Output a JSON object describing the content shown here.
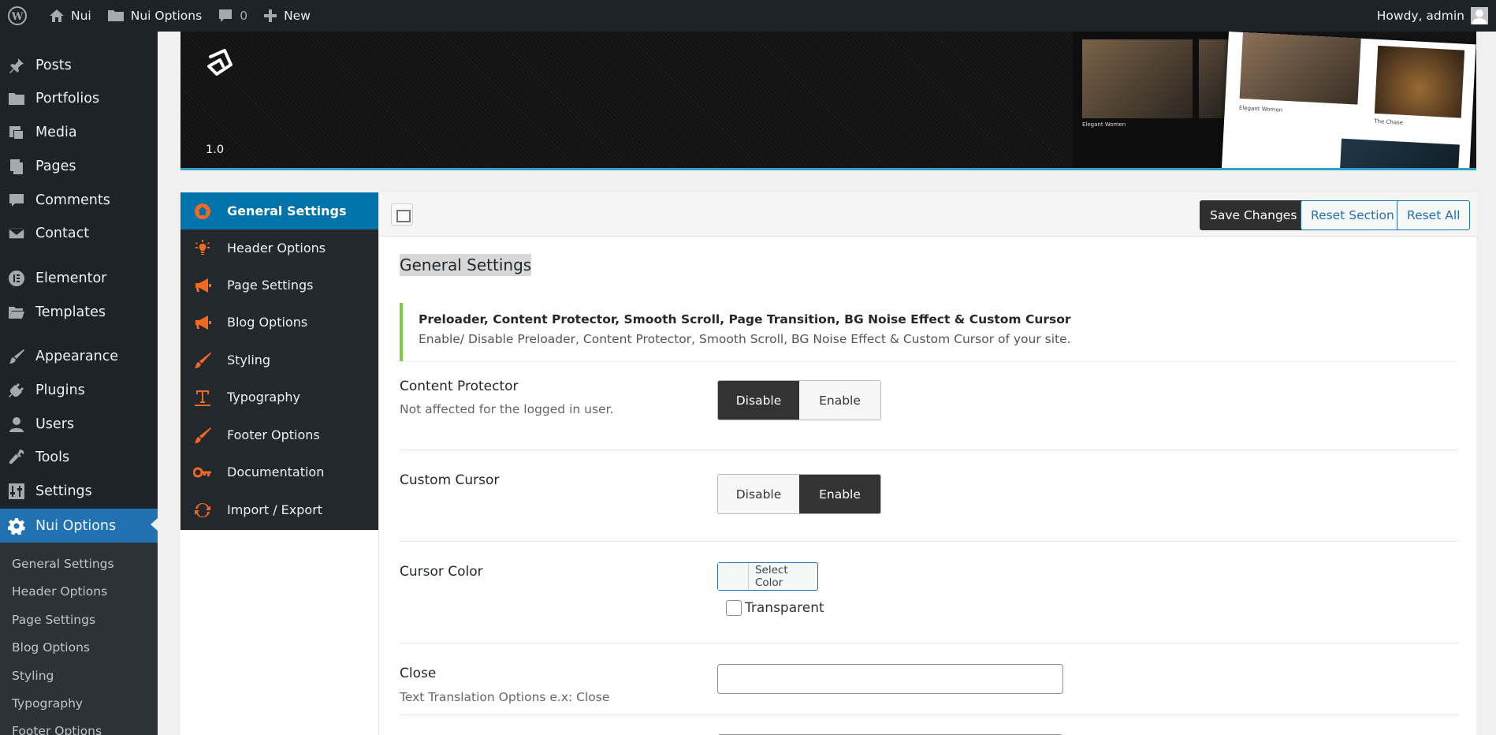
{
  "adminbar": {
    "site_name": "Nui",
    "options_label": "Nui Options",
    "comments_count": "0",
    "new_label": "New",
    "howdy": "Howdy, admin"
  },
  "adminmenu": {
    "items": [
      {
        "label": "Posts",
        "icon": "pushpin-icon"
      },
      {
        "label": "Portfolios",
        "icon": "folder-icon"
      },
      {
        "label": "Media",
        "icon": "media-icon"
      },
      {
        "label": "Pages",
        "icon": "pages-icon"
      },
      {
        "label": "Comments",
        "icon": "comment-icon"
      },
      {
        "label": "Contact",
        "icon": "envelope-icon"
      },
      {
        "label": "Elementor",
        "icon": "elementor-icon"
      },
      {
        "label": "Templates",
        "icon": "folder-open-icon"
      },
      {
        "label": "Appearance",
        "icon": "brush-icon"
      },
      {
        "label": "Plugins",
        "icon": "plug-icon"
      },
      {
        "label": "Users",
        "icon": "user-icon"
      },
      {
        "label": "Tools",
        "icon": "wrench-icon"
      },
      {
        "label": "Settings",
        "icon": "sliders-icon"
      },
      {
        "label": "Nui Options",
        "icon": "gear-icon"
      }
    ],
    "submenu": [
      "General Settings",
      "Header Options",
      "Page Settings",
      "Blog Options",
      "Styling",
      "Typography",
      "Footer Options"
    ]
  },
  "banner": {
    "version": "1.0",
    "caption_1": "Elegant Women",
    "caption_2": "Elegant Women",
    "caption_3": "The Chase"
  },
  "options_nav": {
    "items": [
      {
        "label": "General Settings",
        "icon": "home-icon"
      },
      {
        "label": "Header Options",
        "icon": "lightbulb-icon"
      },
      {
        "label": "Page Settings",
        "icon": "megaphone-icon"
      },
      {
        "label": "Blog Options",
        "icon": "megaphone-icon"
      },
      {
        "label": "Styling",
        "icon": "brush-icon"
      },
      {
        "label": "Typography",
        "icon": "text-icon"
      },
      {
        "label": "Footer Options",
        "icon": "brush-icon"
      },
      {
        "label": "Documentation",
        "icon": "key-icon"
      },
      {
        "label": "Import / Export",
        "icon": "refresh-icon"
      }
    ]
  },
  "toolbar": {
    "save_label": "Save Changes",
    "reset_section_label": "Reset Section",
    "reset_all_label": "Reset All"
  },
  "section": {
    "title": "General Settings",
    "notice_title": "Preloader, Content Protector, Smooth Scroll, Page Transition, BG Noise Effect & Custom Cursor",
    "notice_desc": "Enable/ Disable Preloader, Content Protector, Smooth Scroll, BG Noise Effect & Custom Cursor of your site."
  },
  "fields": {
    "content_protector": {
      "label": "Content Protector",
      "desc": "Not affected for the logged in user.",
      "off": "Disable",
      "on": "Enable",
      "selected": "Disable"
    },
    "custom_cursor": {
      "label": "Custom Cursor",
      "off": "Disable",
      "on": "Enable",
      "selected": "Enable"
    },
    "cursor_color": {
      "label": "Cursor Color",
      "button": "Select Color",
      "transparent": "Transparent"
    },
    "close": {
      "label": "Close",
      "desc": "Text Translation Options e.x: Close",
      "value": ""
    }
  },
  "colors": {
    "accent": "#0073aa",
    "icon_orange": "#f26922",
    "notice_green": "#7ad03a"
  }
}
